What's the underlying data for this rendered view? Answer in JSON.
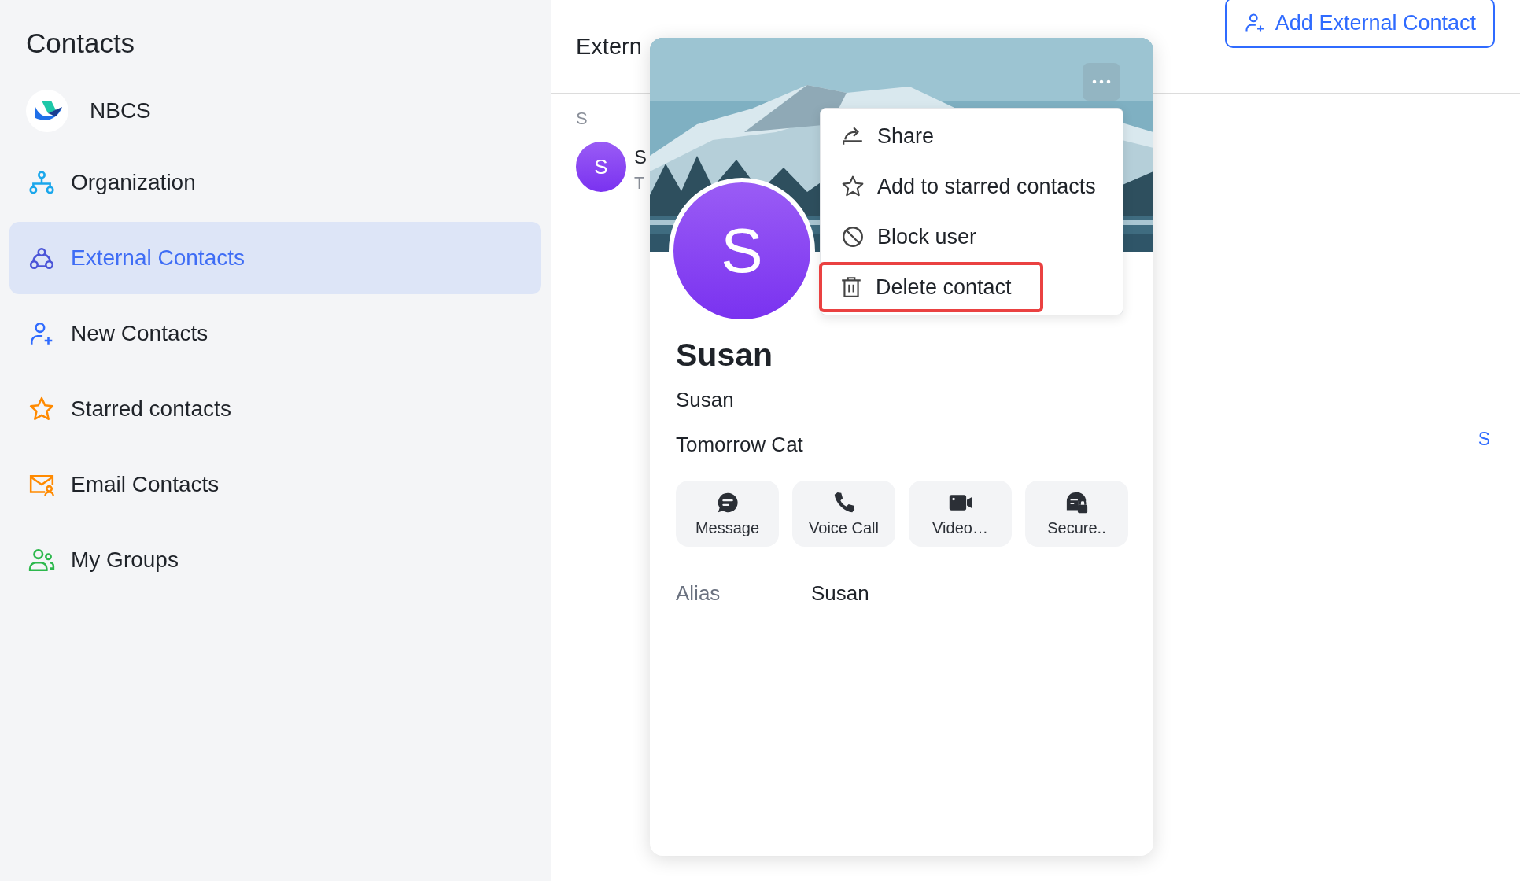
{
  "sidebar": {
    "title": "Contacts",
    "org": {
      "name": "NBCS"
    },
    "items": [
      {
        "kind": "organization",
        "label": "Organization",
        "selected": false
      },
      {
        "kind": "external",
        "label": "External Contacts",
        "selected": true
      },
      {
        "kind": "new",
        "label": "New Contacts",
        "selected": false
      },
      {
        "kind": "starred",
        "label": "Starred contacts",
        "selected": false
      },
      {
        "kind": "email",
        "label": "Email Contacts",
        "selected": false
      },
      {
        "kind": "groups",
        "label": "My Groups",
        "selected": false
      }
    ]
  },
  "main": {
    "title": "Extern",
    "add_button": "Add External Contact",
    "section_letter": "S",
    "contacts": [
      {
        "avatar": "S",
        "name": "S",
        "subtitle": "T"
      }
    ],
    "index": [
      "S"
    ]
  },
  "card": {
    "avatar": "S",
    "name": "Susan",
    "nickname": "Susan",
    "company": "Tomorrow Cat",
    "actions": [
      {
        "kind": "message",
        "label": "Message"
      },
      {
        "kind": "call",
        "label": "Voice Call"
      },
      {
        "kind": "video",
        "label": "Video…"
      },
      {
        "kind": "secure",
        "label": "Secure.."
      }
    ],
    "fields": [
      {
        "label": "Alias",
        "value": "Susan"
      }
    ],
    "menu": {
      "items": [
        {
          "kind": "share",
          "label": "Share",
          "highlighted": false
        },
        {
          "kind": "star",
          "label": "Add to starred contacts",
          "highlighted": false
        },
        {
          "kind": "block",
          "label": "Block user",
          "highlighted": false
        },
        {
          "kind": "delete",
          "label": "Delete contact",
          "highlighted": true
        }
      ]
    }
  }
}
